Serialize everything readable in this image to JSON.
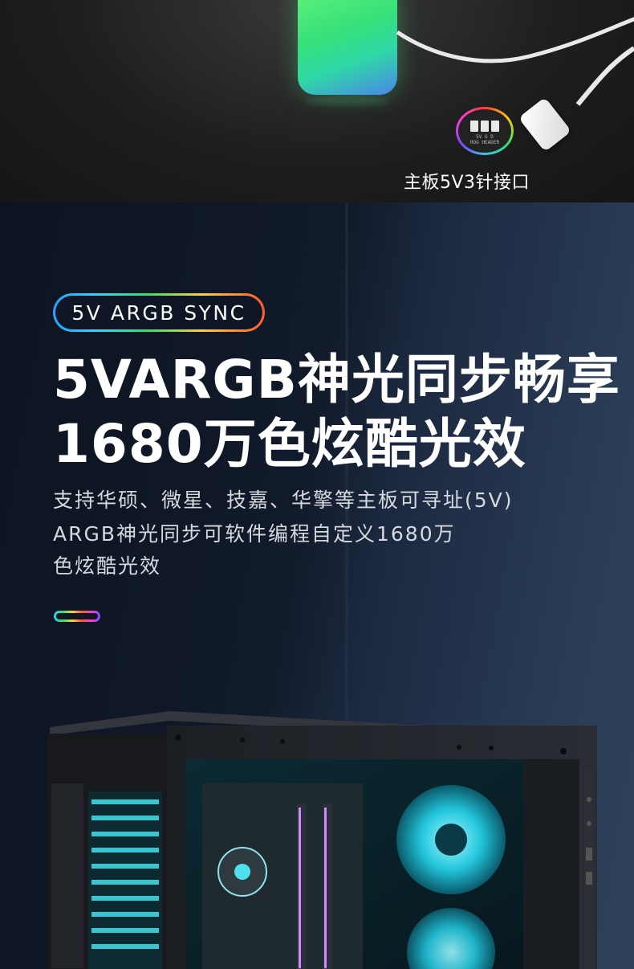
{
  "top_section": {
    "connector_caption": "主板5V3针接口",
    "header_badge_text": "5V G D\nROG HEADER"
  },
  "main_section": {
    "tag": "5V ARGB SYNC",
    "headline_line1": "5VARGB神光同步畅享",
    "headline_line2": "1680万色炫酷光效",
    "description_line1": "支持华硕、微星、技嘉、华擎等主板可寻址(5V)",
    "description_line2": "ARGB神光同步可软件编程自定义1680万",
    "description_line3": "色炫酷光效"
  },
  "colors": {
    "accent_cyan": "#2fc8ff",
    "accent_green": "#35e06e",
    "accent_orange": "#ff5a2a",
    "background_dark": "#0f1624"
  },
  "icons": [
    "argb-hub-icon",
    "rog-header-icon",
    "argb-connector-icon",
    "pc-case-image"
  ]
}
